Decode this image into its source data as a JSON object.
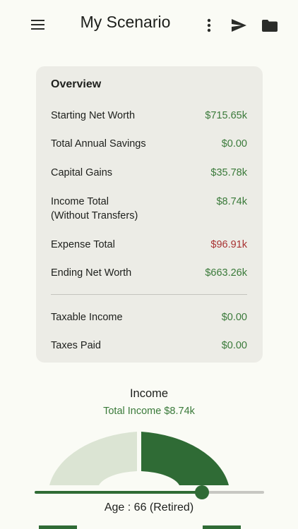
{
  "app": {
    "title": "My Scenario"
  },
  "toolbar": {
    "menu_icon": "hamburger-menu-icon",
    "more_icon": "vertical-dots-icon",
    "send_icon": "send-icon",
    "folder_icon": "folder-icon"
  },
  "overview": {
    "title": "Overview",
    "rows": [
      {
        "label": "Starting Net Worth",
        "value": "$715.65k"
      },
      {
        "label": "Total Annual Savings",
        "value": "$0.00"
      },
      {
        "label": "Capital Gains",
        "value": "$35.78k"
      },
      {
        "label": "Income Total",
        "label2": "(Without Transfers)",
        "value": "$8.74k"
      },
      {
        "label": "Expense Total",
        "value": "$96.91k"
      },
      {
        "label": "Ending Net Worth",
        "value": "$663.26k"
      }
    ],
    "tax_rows": [
      {
        "label": "Taxable Income",
        "value": "$0.00"
      },
      {
        "label": "Taxes Paid",
        "value": "$0.00"
      }
    ]
  },
  "income": {
    "title": "Income",
    "subtitle": "Total Income $8.74k"
  },
  "age_slider": {
    "label": "Age : 66 (Retired)",
    "position_fraction": 0.73
  },
  "colors": {
    "accent": "#2f6b35",
    "positive": "#3a7a3a",
    "negative": "#a83232",
    "gauge_light": "#dbe4d3",
    "card": "#ecece6",
    "background": "#fafbf5"
  }
}
